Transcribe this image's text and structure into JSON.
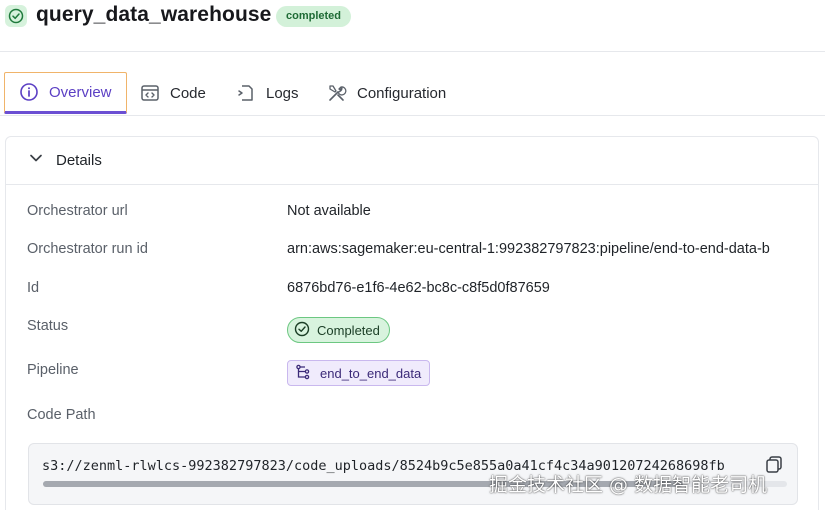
{
  "header": {
    "title": "query_data_warehouse",
    "status_badge": "completed",
    "status_icon": "check-circle-icon"
  },
  "tabs": [
    {
      "label": "Overview",
      "icon": "info-icon",
      "active": true
    },
    {
      "label": "Code",
      "icon": "code-window-icon",
      "active": false
    },
    {
      "label": "Logs",
      "icon": "logs-icon",
      "active": false
    },
    {
      "label": "Configuration",
      "icon": "tools-icon",
      "active": false
    }
  ],
  "details": {
    "section_title": "Details",
    "rows": {
      "orchestrator_url": {
        "label": "Orchestrator url",
        "value": "Not available"
      },
      "orchestrator_run_id": {
        "label": "Orchestrator run id",
        "value": "arn:aws:sagemaker:eu-central-1:992382797823:pipeline/end-to-end-data-b"
      },
      "id": {
        "label": "Id",
        "value": "6876bd76-e1f6-4e62-bc8c-c8f5d0f87659"
      },
      "status": {
        "label": "Status",
        "value": "Completed"
      },
      "pipeline": {
        "label": "Pipeline",
        "value": "end_to_end_data"
      },
      "code_path": {
        "label": "Code Path",
        "value": "s3://zenml-rlwlcs-992382797823/code_uploads/8524b9c5e855a0a41cf4c34a90120724268698fb"
      }
    }
  },
  "watermark": "掘金技术社区 @ 数据智能老司机",
  "colors": {
    "accent": "#6b4fd3",
    "success_bg": "#d8f3de",
    "success_border": "#6cc781",
    "pipeline_bg": "#f0ebfc"
  }
}
